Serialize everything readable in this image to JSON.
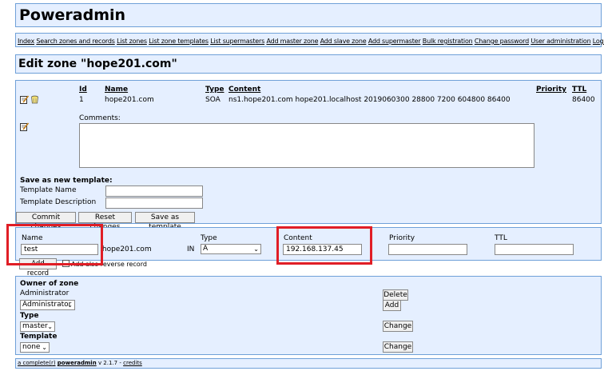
{
  "app": {
    "title": "Poweradmin"
  },
  "nav": [
    "Index",
    "Search zones and records",
    "List zones",
    "List zone templates",
    "List supermasters",
    "Add master zone",
    "Add slave zone",
    "Add supermaster",
    "Bulk registration",
    "Change password",
    "User administration",
    "Logout"
  ],
  "page": {
    "title": "Edit zone \"hope201.com\""
  },
  "records_table": {
    "headers": {
      "id": "Id",
      "name": "Name",
      "type": "Type",
      "content": "Content",
      "priority": "Priority",
      "ttl": "TTL"
    },
    "row": {
      "id": "1",
      "name": "hope201.com",
      "type": "SOA",
      "content": "ns1.hope201.com hope201.localhost 2019060300 28800 7200 604800 86400",
      "priority": "",
      "ttl": "86400"
    },
    "comments_label": "Comments:",
    "comments_value": ""
  },
  "template_form": {
    "heading": "Save as new template:",
    "name_label": "Template Name",
    "description_label": "Template Description",
    "name_value": "",
    "description_value": ""
  },
  "actions": {
    "commit": "Commit changes",
    "reset": "Reset changes",
    "save_template": "Save as template"
  },
  "add_record": {
    "name_label": "Name",
    "name_value": "test",
    "domain_suffix": ".hope201.com",
    "class_label": "IN",
    "type_label": "Type",
    "type_value": "A",
    "content_label": "Content",
    "content_value": "192.168.137.45",
    "priority_label": "Priority",
    "priority_value": "",
    "ttl_label": "TTL",
    "ttl_value": "",
    "add_button": "Add record",
    "reverse_label": "Add also reverse record"
  },
  "zone_owner": {
    "owner_heading": "Owner of zone",
    "owner_value": "Administrator",
    "delete_button": "Delete",
    "owner_select": "Administrator",
    "add_button": "Add",
    "type_heading": "Type",
    "type_select": "master",
    "type_change": "Change",
    "template_heading": "Template",
    "template_select": "none",
    "template_change": "Change"
  },
  "footer": {
    "prefix": "a complete(r)",
    "brand": "poweradmin",
    "version": "v 2.1.7",
    "separator": "-",
    "credits": "credits"
  },
  "colors": {
    "panel_bg": "#e5efff",
    "panel_border": "#6fa0d8",
    "highlight": "#e01e26"
  }
}
